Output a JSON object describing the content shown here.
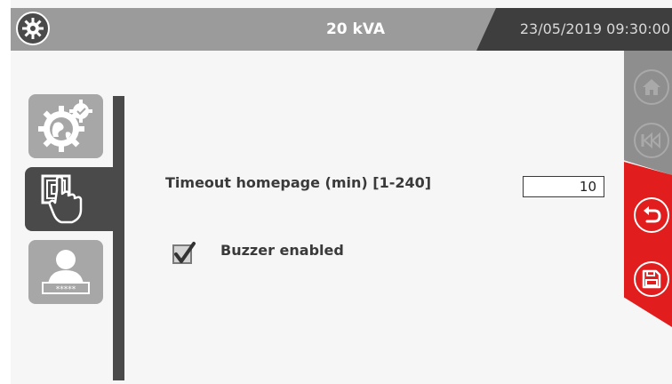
{
  "header": {
    "title": "20 kVA",
    "datetime": "23/05/2019 09:30:00"
  },
  "sidebar": {
    "tabs": [
      {
        "name": "general-settings-tab",
        "icon": "globe-gears-icon",
        "active": false
      },
      {
        "name": "touch-panel-tab",
        "icon": "touch-panel-hand-icon",
        "active": true
      },
      {
        "name": "user-password-tab",
        "icon": "user-password-icon",
        "active": false
      }
    ],
    "password_mask": "*****"
  },
  "content": {
    "timeout_label": "Timeout homepage (min) [1-240]",
    "timeout_value": "10",
    "buzzer_label": "Buzzer enabled",
    "buzzer_checked": true
  },
  "right_nav": {
    "home": {
      "icon": "home-icon",
      "enabled": false
    },
    "back_all": {
      "icon": "rewind-icon",
      "enabled": false
    },
    "undo": {
      "icon": "undo-icon",
      "enabled": true
    },
    "save": {
      "icon": "save-icon",
      "enabled": true
    }
  },
  "colors": {
    "topbar": "#9b9b9b",
    "topbar_dark": "#3e3e3e",
    "accent_red": "#e11d1d",
    "active_tab": "#4a4a4a",
    "inactive_tab": "#a7a7a7"
  }
}
